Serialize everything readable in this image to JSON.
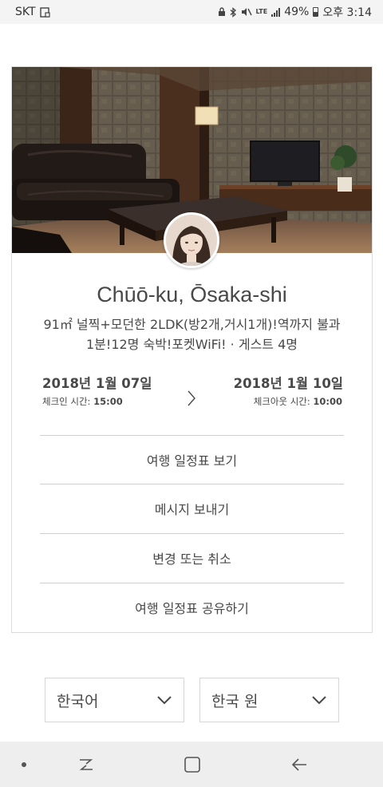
{
  "status_bar": {
    "carrier": "SKT",
    "network": "LTE",
    "battery": "49%",
    "time": "오후 3:14"
  },
  "listing": {
    "city": "Chūō-ku, Ōsaka-shi",
    "description_line1": "91㎡ 널찍+모던한 2LDK(방2개,거시1개)!역까지 불과",
    "description_line2": "1분!12명 숙박!포켓WiFi! · 게스트 4명",
    "checkin_date": "2018년 1월 07일",
    "checkin_time_label": "체크인 시간:",
    "checkin_time": "15:00",
    "checkout_date": "2018년 1월 10일",
    "checkout_time_label": "체크아웃 시간:",
    "checkout_time": "10:00"
  },
  "actions": {
    "view_itinerary": "여행 일정표 보기",
    "send_message": "메시지 보내기",
    "change_or_cancel": "변경 또는 취소",
    "share_itinerary": "여행 일정표 공유하기"
  },
  "footer": {
    "language": "한국어",
    "currency": "한국 원"
  },
  "icons": {
    "chevron": "chevron-right-icon",
    "dropdown": "chevron-down-icon"
  }
}
